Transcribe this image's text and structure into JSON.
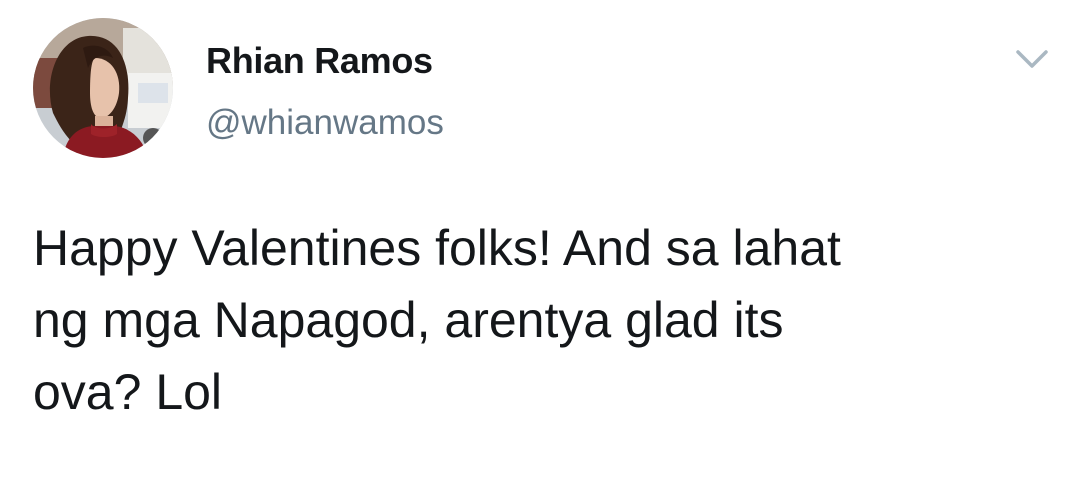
{
  "user": {
    "display_name": "Rhian Ramos",
    "handle": "@whianwamos",
    "avatar_icon": "profile-photo"
  },
  "tweet": {
    "lines": [
      "Happy Valentines folks! And sa lahat",
      "ng mga Napagod, arentya glad its",
      "ova? Lol"
    ]
  },
  "menu": {
    "icon": "chevron-down-icon"
  },
  "colors": {
    "name": "#14171a",
    "handle": "#657786",
    "caret": "#aab8c2"
  }
}
